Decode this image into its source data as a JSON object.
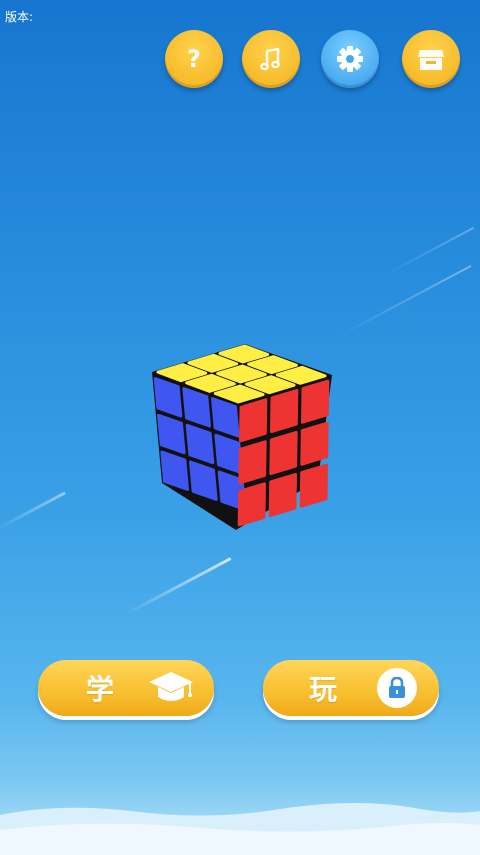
{
  "header": {
    "version_label": "版本:"
  },
  "toolbar": {
    "help_label": "?",
    "music_icon": "music-note-icon",
    "settings_icon": "gear-icon",
    "shop_icon": "store-icon"
  },
  "actions": {
    "learn_label": "学",
    "learn_icon": "graduation-cap-icon",
    "play_label": "玩",
    "play_icon": "lock-icon"
  },
  "colors": {
    "button_yellow": "#f8be2f",
    "button_blue": "#46a8ef",
    "cube_yellow": "#ffee44",
    "cube_red": "#ee3333",
    "cube_blue": "#3f57f0"
  }
}
